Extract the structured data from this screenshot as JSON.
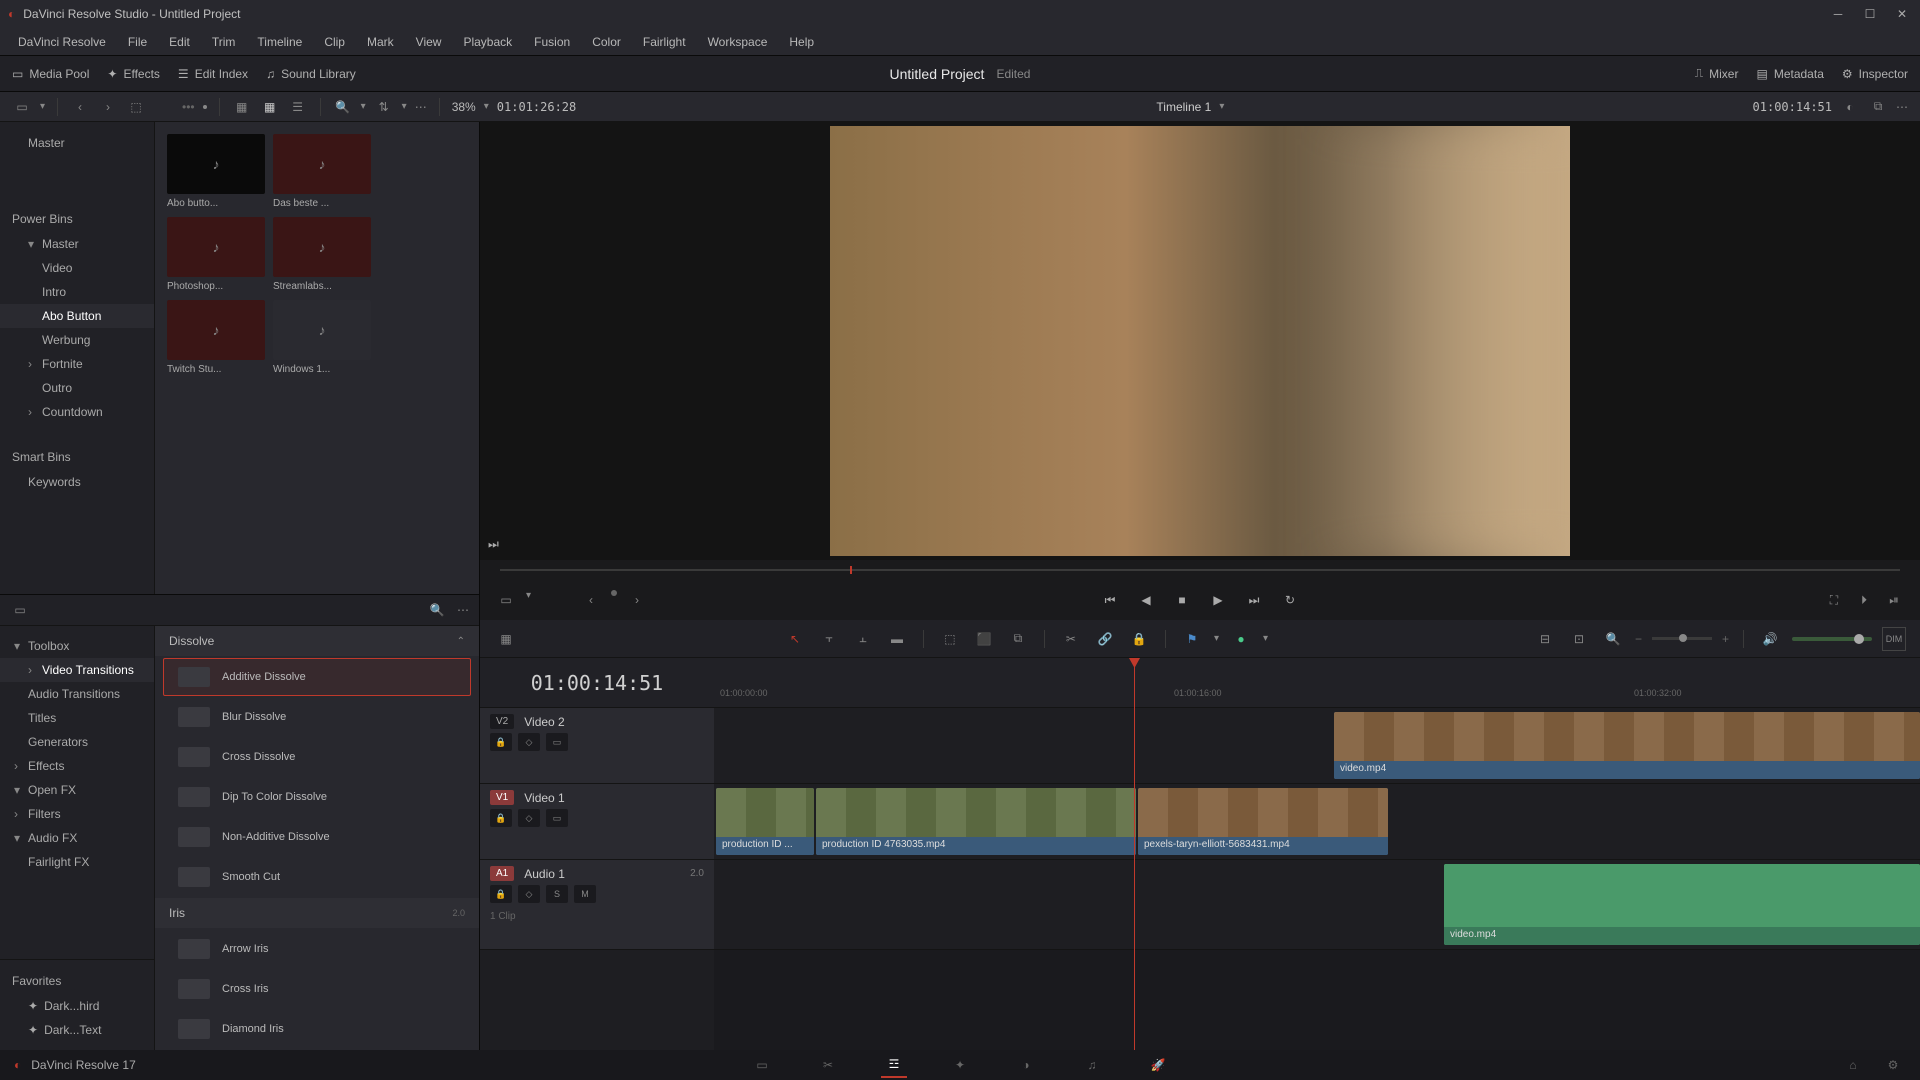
{
  "titlebar": {
    "title": "DaVinci Resolve Studio - Untitled Project"
  },
  "menu": [
    "DaVinci Resolve",
    "File",
    "Edit",
    "Trim",
    "Timeline",
    "Clip",
    "Mark",
    "View",
    "Playback",
    "Fusion",
    "Color",
    "Fairlight",
    "Workspace",
    "Help"
  ],
  "toolbar": {
    "media_pool": "Media Pool",
    "effects": "Effects",
    "edit_index": "Edit Index",
    "sound_library": "Sound Library",
    "project_title": "Untitled Project",
    "project_status": "Edited",
    "mixer": "Mixer",
    "metadata": "Metadata",
    "inspector": "Inspector"
  },
  "sec_toolbar": {
    "zoom": "38%",
    "source_tc": "01:01:26:28",
    "timeline_name": "Timeline 1",
    "record_tc": "01:00:14:51"
  },
  "bin_tree": {
    "master": "Master",
    "power_bins": "Power Bins",
    "power_master": "Master",
    "items": [
      "Video",
      "Intro",
      "Abo Button",
      "Werbung",
      "Fortnite",
      "Outro",
      "Countdown"
    ],
    "smart_bins": "Smart Bins",
    "keywords": "Keywords"
  },
  "clips": [
    {
      "label": "Abo butto..."
    },
    {
      "label": "Das beste ..."
    },
    {
      "label": "Photoshop..."
    },
    {
      "label": "Streamlabs..."
    },
    {
      "label": "Twitch Stu..."
    },
    {
      "label": "Windows 1..."
    }
  ],
  "fx_tree": {
    "toolbox": "Toolbox",
    "video_transitions": "Video Transitions",
    "audio_transitions": "Audio Transitions",
    "titles": "Titles",
    "generators": "Generators",
    "effects": "Effects",
    "openfx": "Open FX",
    "filters": "Filters",
    "audiofx": "Audio FX",
    "fairlightfx": "Fairlight FX",
    "favorites": "Favorites",
    "fav1": "Dark...hird",
    "fav2": "Dark...Text"
  },
  "fx_list": {
    "cat_dissolve": "Dissolve",
    "dissolve": [
      "Additive Dissolve",
      "Blur Dissolve",
      "Cross Dissolve",
      "Dip To Color Dissolve",
      "Non-Additive Dissolve",
      "Smooth Cut"
    ],
    "cat_iris": "Iris",
    "iris_badge": "2.0",
    "iris": [
      "Arrow Iris",
      "Cross Iris",
      "Diamond Iris"
    ]
  },
  "timeline": {
    "big_tc": "01:00:14:51",
    "tracks": {
      "v2": {
        "badge": "V2",
        "name": "Video 2"
      },
      "v1": {
        "badge": "V1",
        "name": "Video 1"
      },
      "a1": {
        "badge": "A1",
        "name": "Audio 1",
        "ch": "2.0",
        "clips_label": "1 Clip"
      }
    },
    "ruler": [
      "01:00:00:00",
      "01:00:16:00",
      "01:00:32:00"
    ],
    "clips": {
      "v2_1": "video.mp4",
      "v1_1": "production ID ...",
      "v1_2": "production ID 4763035.mp4",
      "v1_3": "pexels-taryn-elliott-5683431.mp4",
      "a1_1": "video.mp4"
    }
  },
  "footer": {
    "version": "DaVinci Resolve 17"
  }
}
